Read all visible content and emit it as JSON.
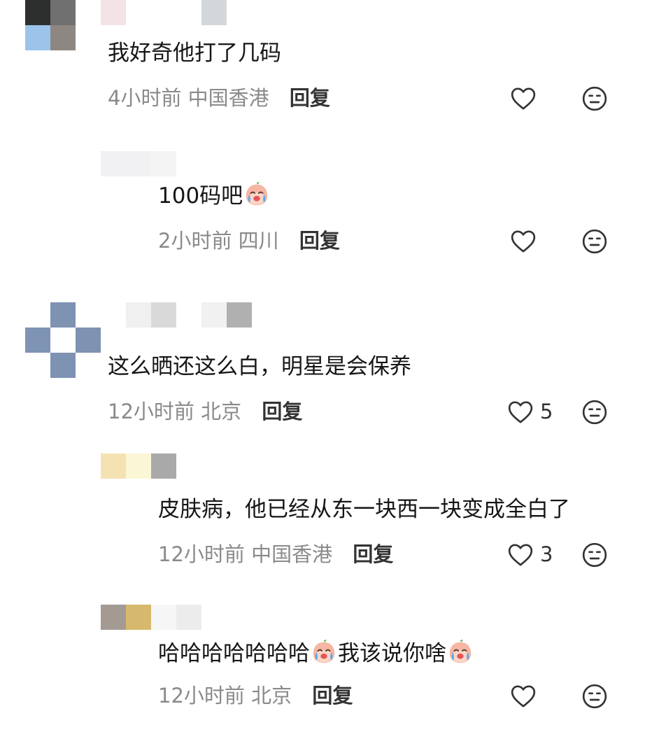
{
  "comments": [
    {
      "text": "我好奇他打了几码",
      "time": "4小时前",
      "location": "中国香港",
      "reply_label": "回复",
      "likes": ""
    },
    {
      "text": "100码吧",
      "time": "2小时前",
      "location": "四川",
      "reply_label": "回复",
      "likes": ""
    },
    {
      "text": "这么晒还这么白，明星是会保养",
      "time": "12小时前",
      "location": "北京",
      "reply_label": "回复",
      "likes": "5"
    },
    {
      "text": "皮肤病，他已经从东一块西一块变成全白了",
      "time": "12小时前",
      "location": "中国香港",
      "reply_label": "回复",
      "likes": "3"
    },
    {
      "text_part1": "哈哈哈哈哈哈哈",
      "text_part2": "我该说你啥",
      "time": "12小时前",
      "location": "北京",
      "reply_label": "回复",
      "likes": ""
    }
  ],
  "icons": {
    "like": "heart-outline-icon",
    "dislike": "neutral-face-icon",
    "emoji": "crying-peach-emoji"
  },
  "colors": {
    "meta": "#8a8a8a",
    "text": "#161616",
    "icon": "#333333"
  }
}
